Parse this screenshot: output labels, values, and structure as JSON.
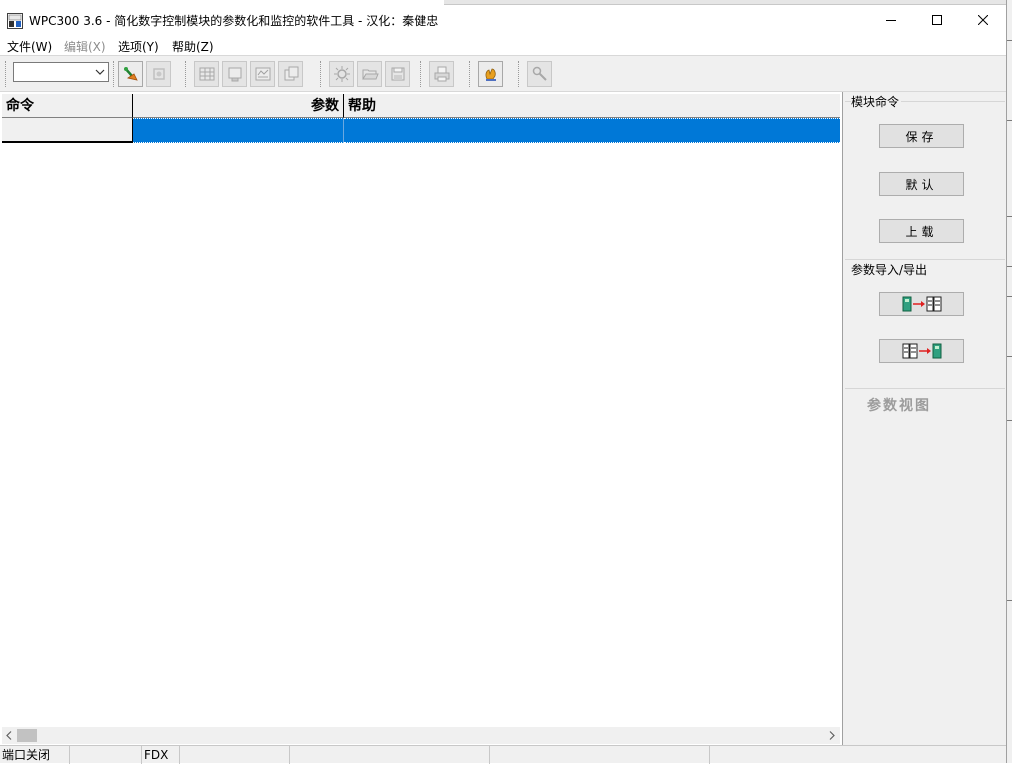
{
  "window": {
    "title": "WPC300 3.6 - 简化数字控制模块的参数化和监控的软件工具   -  汉化：秦健忠",
    "icon": "wpc-app-icon",
    "buttons": {
      "minimize": "minimize-icon",
      "maximize": "maximize-icon",
      "close": "close-icon"
    }
  },
  "menu": {
    "file": "文件(W)",
    "edit": "编辑(X)",
    "options": "选项(Y)",
    "help": "帮助(Z)"
  },
  "toolbar": {
    "combo_value": "",
    "icons": [
      "connect-icon",
      "disconnect-icon",
      "table-icon",
      "window-icon",
      "list-icon",
      "copy-icon",
      "settings-icon",
      "open-icon",
      "save-icon",
      "print-icon",
      "monitor-icon",
      "tools-icon"
    ]
  },
  "grid": {
    "columns": [
      "命令",
      "参数",
      "帮助"
    ],
    "rows": [
      {
        "command": "",
        "param": "",
        "help": ""
      }
    ]
  },
  "panel": {
    "module_commands_title": "模块命令",
    "save_label": "保存",
    "default_label": "默认",
    "upload_label": "上载",
    "import_export_title": "参数导入/导出",
    "import_icon": "import-icon",
    "export_icon": "export-icon",
    "param_view_label": "参数视图"
  },
  "status": {
    "port": "端口关闭",
    "fdx": "FDX"
  },
  "colors": {
    "selection": "#0078d7",
    "window_bg": "#f0f0f0"
  }
}
